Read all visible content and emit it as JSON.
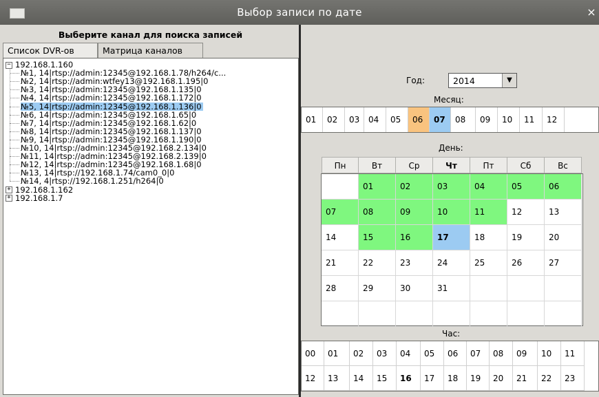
{
  "window": {
    "title": "Выбор записи по дате",
    "close_glyph": "×",
    "icon": "window-icon"
  },
  "heading": "Выберите канал для поиска записей",
  "tabs": [
    {
      "label": "Список DVR-ов",
      "active": true
    },
    {
      "label": "Матрица каналов",
      "active": false
    }
  ],
  "tree": {
    "nodes": [
      {
        "label": "192.168.1.160",
        "expanded": true,
        "expander": "−",
        "children": [
          {
            "label": "№1, 14|rtsp://admin:12345@192.168.1.78/h264/c...",
            "selected": false
          },
          {
            "label": "№2, 14|rtsp://admin:wtfey13@192.168.1.195|0",
            "selected": false
          },
          {
            "label": "№3, 14|rtsp://admin:12345@192.168.1.135|0",
            "selected": false
          },
          {
            "label": "№4, 14|rtsp://admin:12345@192.168.1.172|0",
            "selected": false
          },
          {
            "label": "№5, 14|rtsp://admin:12345@192.168.1.136|0",
            "selected": true
          },
          {
            "label": "№6, 14|rtsp://admin:12345@192.168.1.65|0",
            "selected": false
          },
          {
            "label": "№7, 14|rtsp://admin:12345@192.168.1.62|0",
            "selected": false
          },
          {
            "label": "№8, 14|rtsp://admin:12345@192.168.1.137|0",
            "selected": false
          },
          {
            "label": "№9, 14|rtsp://admin:12345@192.168.1.190|0",
            "selected": false
          },
          {
            "label": "№10, 14|rtsp://admin:12345@192.168.2.134|0",
            "selected": false
          },
          {
            "label": "№11, 14|rtsp://admin:12345@192.168.2.139|0",
            "selected": false
          },
          {
            "label": "№12, 14|rtsp://admin:12345@192.168.1.68|0",
            "selected": false
          },
          {
            "label": "№13, 14|rtsp://192.168.1.74/cam0_0|0",
            "selected": false
          },
          {
            "label": "№14, 4|rtsp://192.168.1.251/h264|0",
            "selected": false
          }
        ]
      },
      {
        "label": "192.168.1.162",
        "expanded": false,
        "expander": "+",
        "children": []
      },
      {
        "label": "192.168.1.7",
        "expanded": false,
        "expander": "+",
        "children": []
      }
    ]
  },
  "year": {
    "label": "Год:",
    "value": "2014"
  },
  "months": {
    "label": "Месяц:",
    "items": [
      {
        "v": "01",
        "s": ""
      },
      {
        "v": "02",
        "s": ""
      },
      {
        "v": "03",
        "s": ""
      },
      {
        "v": "04",
        "s": ""
      },
      {
        "v": "05",
        "s": ""
      },
      {
        "v": "06",
        "s": "orange"
      },
      {
        "v": "07",
        "s": "blue"
      },
      {
        "v": "08",
        "s": ""
      },
      {
        "v": "09",
        "s": ""
      },
      {
        "v": "10",
        "s": ""
      },
      {
        "v": "11",
        "s": ""
      },
      {
        "v": "12",
        "s": ""
      }
    ]
  },
  "days": {
    "label": "День:",
    "headers": [
      "Пн",
      "Вт",
      "Ср",
      "Чт",
      "Пт",
      "Сб",
      "Вс"
    ],
    "bold_header": 3,
    "weeks": [
      [
        {
          "v": "",
          "s": ""
        },
        {
          "v": "01",
          "s": "green"
        },
        {
          "v": "02",
          "s": "green"
        },
        {
          "v": "03",
          "s": "green"
        },
        {
          "v": "04",
          "s": "green"
        },
        {
          "v": "05",
          "s": "green"
        },
        {
          "v": "06",
          "s": "green"
        }
      ],
      [
        {
          "v": "07",
          "s": "green"
        },
        {
          "v": "08",
          "s": "green"
        },
        {
          "v": "09",
          "s": "green"
        },
        {
          "v": "10",
          "s": "green"
        },
        {
          "v": "11",
          "s": "green"
        },
        {
          "v": "12",
          "s": ""
        },
        {
          "v": "13",
          "s": ""
        }
      ],
      [
        {
          "v": "14",
          "s": ""
        },
        {
          "v": "15",
          "s": "green"
        },
        {
          "v": "16",
          "s": "green"
        },
        {
          "v": "17",
          "s": "blue"
        },
        {
          "v": "18",
          "s": ""
        },
        {
          "v": "19",
          "s": ""
        },
        {
          "v": "20",
          "s": ""
        }
      ],
      [
        {
          "v": "21",
          "s": ""
        },
        {
          "v": "22",
          "s": ""
        },
        {
          "v": "23",
          "s": ""
        },
        {
          "v": "24",
          "s": ""
        },
        {
          "v": "25",
          "s": ""
        },
        {
          "v": "26",
          "s": ""
        },
        {
          "v": "27",
          "s": ""
        }
      ],
      [
        {
          "v": "28",
          "s": ""
        },
        {
          "v": "29",
          "s": ""
        },
        {
          "v": "30",
          "s": ""
        },
        {
          "v": "31",
          "s": ""
        },
        {
          "v": "",
          "s": ""
        },
        {
          "v": "",
          "s": ""
        },
        {
          "v": "",
          "s": ""
        }
      ],
      [
        {
          "v": "",
          "s": ""
        },
        {
          "v": "",
          "s": ""
        },
        {
          "v": "",
          "s": ""
        },
        {
          "v": "",
          "s": ""
        },
        {
          "v": "",
          "s": ""
        },
        {
          "v": "",
          "s": ""
        },
        {
          "v": "",
          "s": ""
        }
      ]
    ]
  },
  "hours": {
    "label": "Час:",
    "rows": [
      [
        {
          "v": "00",
          "s": ""
        },
        {
          "v": "01",
          "s": ""
        },
        {
          "v": "02",
          "s": ""
        },
        {
          "v": "03",
          "s": ""
        },
        {
          "v": "04",
          "s": ""
        },
        {
          "v": "05",
          "s": ""
        },
        {
          "v": "06",
          "s": ""
        },
        {
          "v": "07",
          "s": ""
        },
        {
          "v": "08",
          "s": ""
        },
        {
          "v": "09",
          "s": ""
        },
        {
          "v": "10",
          "s": "pink"
        },
        {
          "v": "11",
          "s": "pink"
        }
      ],
      [
        {
          "v": "12",
          "s": "pink"
        },
        {
          "v": "13",
          "s": "pink"
        },
        {
          "v": "14",
          "s": "pink"
        },
        {
          "v": "15",
          "s": "pink"
        },
        {
          "v": "16",
          "s": "blue"
        },
        {
          "v": "17",
          "s": ""
        },
        {
          "v": "18",
          "s": ""
        },
        {
          "v": "19",
          "s": ""
        },
        {
          "v": "20",
          "s": ""
        },
        {
          "v": "21",
          "s": ""
        },
        {
          "v": "22",
          "s": ""
        },
        {
          "v": "23",
          "s": ""
        }
      ]
    ]
  },
  "colors": {
    "has_records": "#7ff77f",
    "selected": "#9ccbf2",
    "month_other": "#f9c37f",
    "hour_records": "#f4a3c8",
    "titlebar": "#6a6a66"
  }
}
